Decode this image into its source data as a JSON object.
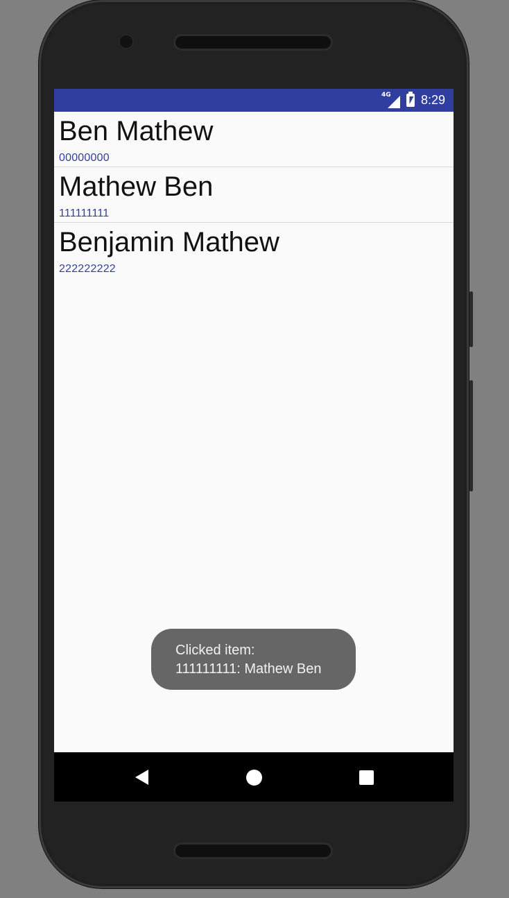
{
  "status_bar": {
    "network_label": "4G",
    "time": "8:29",
    "color": "#303f9f"
  },
  "contacts": [
    {
      "name": "Ben Mathew",
      "number": "00000000"
    },
    {
      "name": "Mathew Ben",
      "number": "111111111"
    },
    {
      "name": "Benjamin Mathew",
      "number": "222222222"
    }
  ],
  "toast": {
    "line1": "Clicked item:",
    "line2": "111111111: Mathew Ben"
  },
  "nav": {
    "back_icon": "back-icon",
    "home_icon": "home-icon",
    "recents_icon": "recents-icon"
  }
}
